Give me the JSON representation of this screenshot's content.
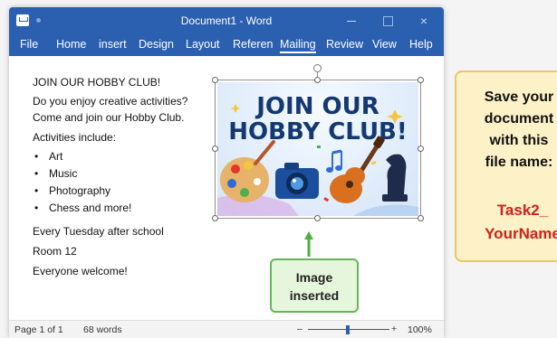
{
  "window": {
    "title": "Document1 - Word",
    "close_glyph": "×"
  },
  "menu": {
    "items": [
      "File",
      "Home",
      "insert",
      "Design",
      "Layout",
      "Referen",
      "Mailing",
      "Review",
      "View",
      "Help"
    ],
    "active": "Mailing"
  },
  "document": {
    "heading": "JOIN OUR HOBBY CLUB!",
    "intro_1": "Do you enjoy creative activities?",
    "intro_2": "Come and join our Hobby Club.",
    "activities_label": "Activities include:",
    "activities": [
      "Art",
      "Music",
      "Photography",
      "Chess and more!"
    ],
    "schedule": "Every Tuesday after school",
    "room": "Room 12",
    "welcome": "Everyone welcome!"
  },
  "poster": {
    "line1": "JOIN OUR",
    "line2": "HOBBY CLUB!",
    "icons": [
      "palette-icon",
      "camera-icon",
      "guitar-icon",
      "chess-knight-icon",
      "music-note-icon"
    ]
  },
  "callout": {
    "line1": "Image",
    "line2": "inserted"
  },
  "status": {
    "page": "Page 1 of 1",
    "words": "68 words",
    "zoom_minus": "–",
    "zoom_plus": "+",
    "zoom": "100%"
  },
  "note": {
    "line1": "Save your",
    "line2": "document",
    "line3": "with this",
    "line4": "file name:",
    "name1": "Task2_",
    "name2": "YourName"
  },
  "colors": {
    "titlebar": "#2b5fb0",
    "callout_border": "#66b558",
    "note_bg": "#fdf1c7",
    "file_name": "#d0211b"
  }
}
